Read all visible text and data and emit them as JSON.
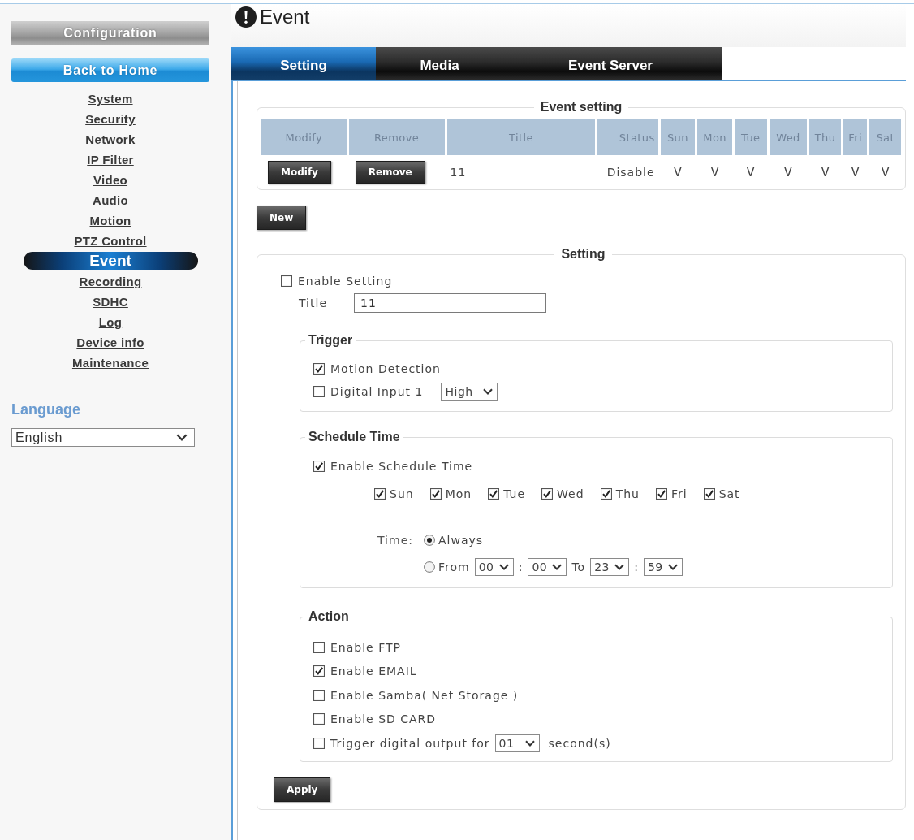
{
  "sidebar": {
    "header": "Configuration",
    "home_button": "Back to Home",
    "items": [
      {
        "label": "System",
        "selected": false
      },
      {
        "label": "Security",
        "selected": false
      },
      {
        "label": "Network",
        "selected": false
      },
      {
        "label": "IP Filter",
        "selected": false
      },
      {
        "label": "Video",
        "selected": false
      },
      {
        "label": "Audio",
        "selected": false
      },
      {
        "label": "Motion",
        "selected": false
      },
      {
        "label": "PTZ Control",
        "selected": false
      },
      {
        "label": "Event",
        "selected": true
      },
      {
        "label": "Recording",
        "selected": false
      },
      {
        "label": "SDHC",
        "selected": false
      },
      {
        "label": "Log",
        "selected": false
      },
      {
        "label": "Device info",
        "selected": false
      },
      {
        "label": "Maintenance",
        "selected": false
      }
    ],
    "language": {
      "label": "Language",
      "value": "English"
    }
  },
  "page": {
    "title": "Event"
  },
  "tabs": [
    {
      "label": "Setting",
      "selected": true
    },
    {
      "label": "Media",
      "selected": false
    },
    {
      "label": "Event Server",
      "selected": false
    }
  ],
  "event_table": {
    "legend": "Event setting",
    "columns": [
      "Modify",
      "Remove",
      "Title",
      "Status",
      "Sun",
      "Mon",
      "Tue",
      "Wed",
      "Thu",
      "Fri",
      "Sat"
    ],
    "rows": [
      {
        "modify": "Modify",
        "remove": "Remove",
        "title": "11",
        "status": "Disable",
        "days": [
          "V",
          "V",
          "V",
          "V",
          "V",
          "V",
          "V"
        ]
      }
    ]
  },
  "new_button": "New",
  "setting": {
    "legend": "Setting",
    "enable": {
      "label": "Enable Setting",
      "checked": false
    },
    "title": {
      "label": "Title",
      "value": "11"
    },
    "trigger": {
      "legend": "Trigger",
      "items": [
        {
          "kind": "checkbox",
          "label": "Motion Detection",
          "checked": true
        },
        {
          "kind": "checkbox_select",
          "label": "Digital Input 1",
          "checked": false,
          "value": "High"
        }
      ]
    },
    "schedule": {
      "legend": "Schedule Time",
      "enable": {
        "label": "Enable Schedule Time",
        "checked": true
      },
      "days": [
        {
          "label": "Sun",
          "checked": true
        },
        {
          "label": "Mon",
          "checked": true
        },
        {
          "label": "Tue",
          "checked": true
        },
        {
          "label": "Wed",
          "checked": true
        },
        {
          "label": "Thu",
          "checked": true
        },
        {
          "label": "Fri",
          "checked": true
        },
        {
          "label": "Sat",
          "checked": true
        }
      ],
      "time": {
        "label": "Time:",
        "options": [
          {
            "kind": "always",
            "label": "Always",
            "selected": true
          },
          {
            "kind": "range",
            "label": "From",
            "selected": false,
            "parts": [
              {
                "kind": "select",
                "value": "00"
              },
              {
                "kind": "text",
                "text": ":"
              },
              {
                "kind": "select",
                "value": "00"
              },
              {
                "kind": "text",
                "text": "To"
              },
              {
                "kind": "select",
                "value": "23"
              },
              {
                "kind": "text",
                "text": ":"
              },
              {
                "kind": "select",
                "value": "59"
              }
            ]
          }
        ]
      }
    },
    "action": {
      "legend": "Action",
      "items": [
        {
          "kind": "checkbox",
          "label": "Enable FTP",
          "checked": false
        },
        {
          "kind": "checkbox",
          "label": "Enable EMAIL",
          "checked": true
        },
        {
          "kind": "checkbox",
          "label": "Enable Samba( Net Storage )",
          "checked": false
        },
        {
          "kind": "checkbox",
          "label": "Enable SD CARD",
          "checked": false
        },
        {
          "kind": "checkbox_duration",
          "label": "Trigger digital output for",
          "checked": false,
          "value": "01",
          "unit": "second(s)"
        }
      ]
    },
    "apply_button": "Apply"
  }
}
